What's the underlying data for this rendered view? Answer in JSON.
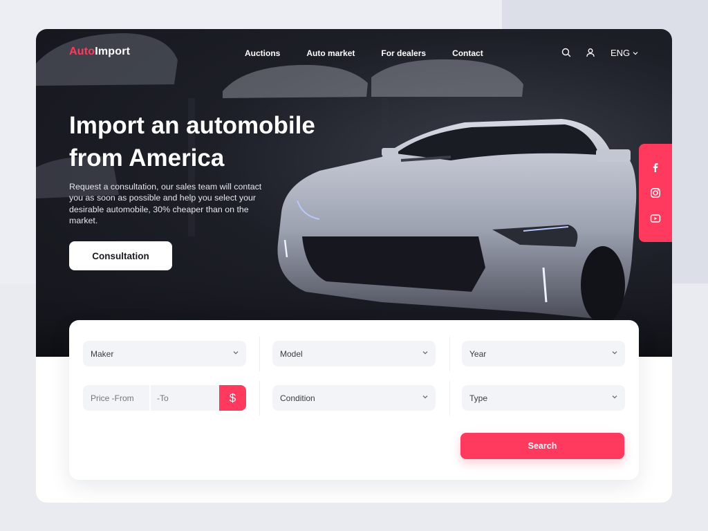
{
  "brand": {
    "prefix": "Auto",
    "suffix": "Import",
    "accent_color": "#ff3a5e"
  },
  "nav": {
    "links": [
      "Auctions",
      "Auto market",
      "For dealers",
      "Contact"
    ],
    "search_icon": "search-icon",
    "user_icon": "user-icon",
    "language": "ENG"
  },
  "hero": {
    "title": "Import an automobile from America",
    "description": "Request a consultation, our sales team will contact you as soon as possible and help you select your desirable automobile, 30% cheaper than on the market.",
    "cta_label": "Consultation"
  },
  "social": [
    "facebook-icon",
    "instagram-icon",
    "youtube-icon"
  ],
  "filters": {
    "maker": "Maker",
    "model": "Model",
    "year": "Year",
    "price_from_placeholder": "Price -From",
    "price_to_placeholder": "-To",
    "currency_symbol": "$",
    "condition": "Condition",
    "type": "Type",
    "search_label": "Search"
  }
}
